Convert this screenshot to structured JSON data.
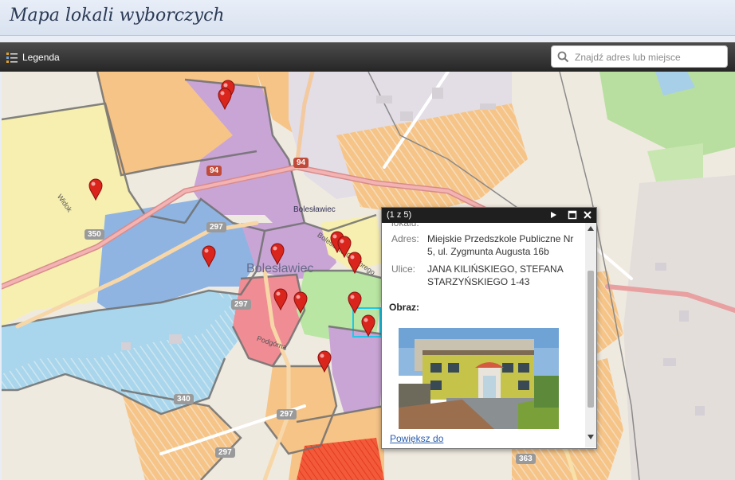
{
  "page": {
    "title": "Mapa lokali wyborczych"
  },
  "toolbar": {
    "legend_label": "Legenda",
    "search_placeholder": "Znajdź adres lub miejsce"
  },
  "map": {
    "labels": {
      "city": "Bolesławiec",
      "street_top": "Bolesławiec",
      "street_chrobrego": "Bolesława Chrobrego",
      "street_podgorna": "Podgórna",
      "street_widok": "Widok"
    },
    "road_badges": [
      "94",
      "94",
      "350",
      "297",
      "297",
      "340",
      "297",
      "363",
      "297"
    ]
  },
  "popup": {
    "counter": "(1 z 5)",
    "partial_label": "lokalu:",
    "address_label": "Adres:",
    "address_value": "Miejskie Przedszkole Publiczne Nr 5, ul. Zygmunta Augusta 16b",
    "streets_label": "Ulice:",
    "streets_value": "JANA KILIŃSKIEGO, STEFANA STARZYŃSKIEGO 1-43",
    "image_heading": "Obraz:",
    "zoom_link": "Powiększ do"
  },
  "colors": {
    "marker": "#d9251c",
    "zone_purple": "#c9a5d6",
    "zone_blue": "#8fb4e2",
    "zone_lightblue": "#a9d6ec",
    "zone_yellow": "#f7efb0",
    "zone_orange": "#f6c487",
    "zone_pink": "#f08c94",
    "zone_green": "#b9e6a3",
    "highlight": "#1ec8e6"
  },
  "icons": {
    "legend": "legend-list-icon",
    "search": "search-icon",
    "next": "play-next-icon",
    "maximize": "maximize-icon",
    "close": "close-icon"
  }
}
